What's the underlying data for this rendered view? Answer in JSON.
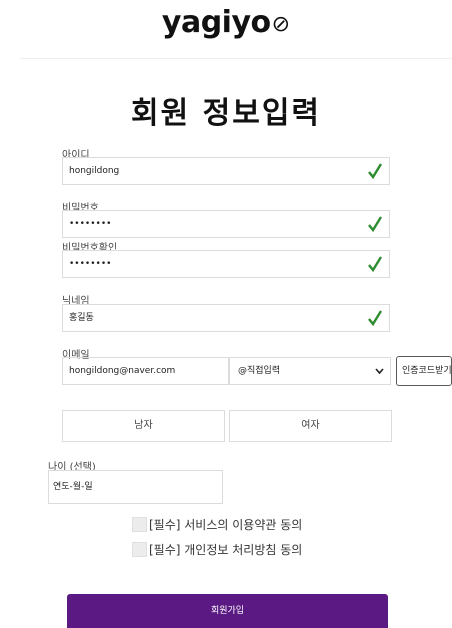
{
  "header": {
    "logo_text": "yagiyo",
    "logo_mark": "⊘"
  },
  "title": "회원 정보입력",
  "fields": {
    "id": {
      "label": "아이디",
      "value": "hongildong",
      "valid": true
    },
    "password": {
      "label": "비밀번호",
      "value": "••••••••",
      "valid": true
    },
    "password_confirm": {
      "label": "비밀번호확인",
      "value": "••••••••",
      "valid": true
    },
    "nickname": {
      "label": "닉네임",
      "value": "홍길동",
      "valid": true
    },
    "email": {
      "label": "이메일",
      "value": "hongildong@naver.com",
      "domain_selected": "@직접입력",
      "verify_button": "인증코드받기"
    },
    "gender": {
      "male": "남자",
      "female": "여자"
    },
    "age": {
      "label": "나이 (선택)",
      "value": "연도-월-일"
    }
  },
  "agreements": [
    {
      "text": "[필수] 서비스의 이용약관 동의",
      "checked": false
    },
    {
      "text": "[필수] 개인정보 처리방침 동의",
      "checked": false
    }
  ],
  "submit_label": "회원가입",
  "colors": {
    "brand": "#5b1a83",
    "check": "#2e8b2e",
    "border": "#dcdcdc"
  }
}
